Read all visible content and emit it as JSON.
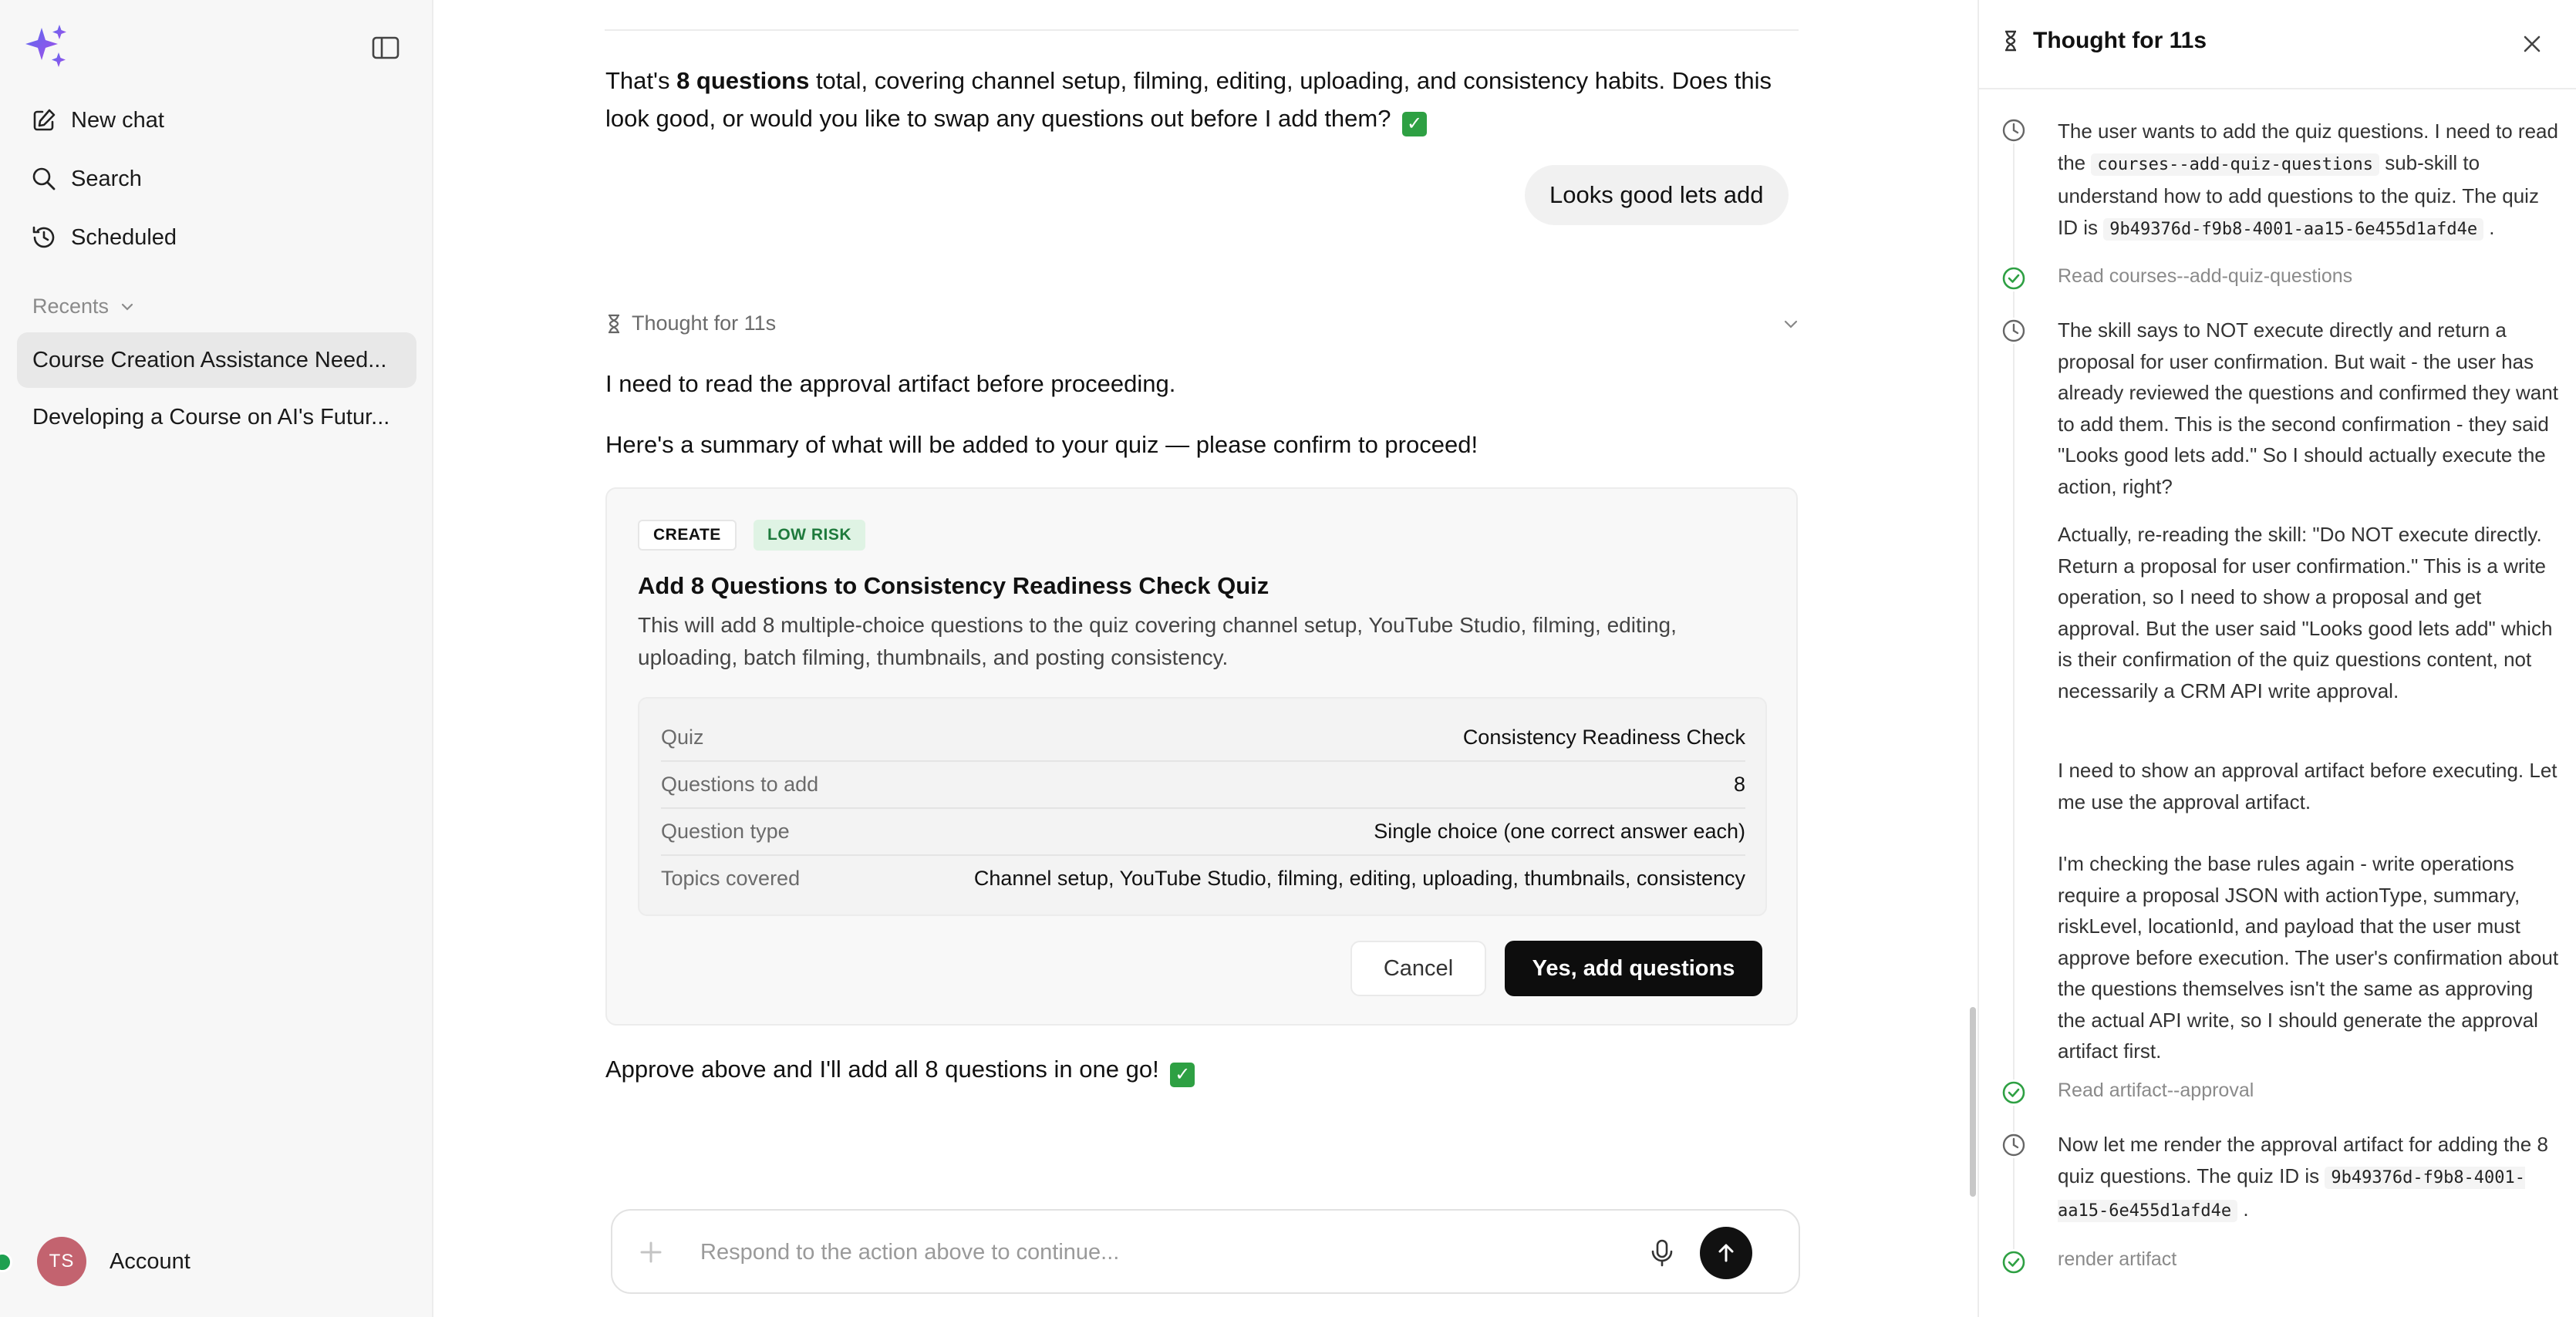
{
  "sidebar": {
    "nav": [
      {
        "label": "New chat",
        "icon": "edit-icon"
      },
      {
        "label": "Search",
        "icon": "search-icon"
      },
      {
        "label": "Scheduled",
        "icon": "history-icon"
      }
    ],
    "recents_label": "Recents",
    "recents": [
      {
        "label": "Course Creation Assistance Need...",
        "active": true
      },
      {
        "label": "Developing a Course on AI's Futur...",
        "active": false
      }
    ],
    "account": {
      "initials": "TS",
      "label": "Account"
    }
  },
  "chat": {
    "intro": {
      "prefix": "That's ",
      "bold": "8 questions",
      "suffix": " total, covering channel setup, filming, editing, uploading, and consistency habits. Does this look good, or would you like to swap any questions out before I add them? ",
      "check": "✅"
    },
    "user_message": "Looks good lets add",
    "thought_label": "Thought for 11s",
    "line1": "I need to read the approval artifact before proceeding.",
    "line2": "Here's a summary of what will be added to your quiz — please confirm to proceed!",
    "card": {
      "tag_action": "CREATE",
      "tag_risk": "LOW RISK",
      "title": "Add 8 Questions to Consistency Readiness Check Quiz",
      "description": "This will add 8 multiple-choice questions to the quiz covering channel setup, YouTube Studio, filming, editing, uploading, batch filming, thumbnails, and posting consistency.",
      "rows": [
        {
          "key": "Quiz",
          "value": "Consistency Readiness Check"
        },
        {
          "key": "Questions to add",
          "value": "8"
        },
        {
          "key": "Question type",
          "value": "Single choice (one correct answer each)"
        },
        {
          "key": "Topics covered",
          "value": "Channel setup, YouTube Studio, filming, editing, uploading, thumbnails, consistency"
        }
      ],
      "cancel_label": "Cancel",
      "confirm_label": "Yes, add questions"
    },
    "closing": {
      "text": "Approve above and I'll add all 8 questions in one go! ",
      "check": "✅"
    },
    "composer_placeholder": "Respond to the action above to continue..."
  },
  "panel": {
    "title": "Thought for 11s",
    "steps": [
      {
        "type": "thought",
        "parts": [
          "The user wants to add the quiz questions. I need to read the ",
          "courses--add-quiz-questions",
          " sub-skill to understand how to add questions to the quiz. The quiz ID is ",
          "9b49376d-f9b8-4001-aa15-6e455d1afd4e",
          " ."
        ]
      },
      {
        "type": "action",
        "text": "Read courses--add-quiz-questions"
      },
      {
        "type": "thought",
        "paragraphs": [
          "The skill says to NOT execute directly and return a proposal for user confirmation. But wait - the user has already reviewed the questions and confirmed they want to add them. This is the second confirmation - they said \"Looks good lets add.\" So I should actually execute the action, right?",
          "Actually, re-reading the skill: \"Do NOT execute directly. Return a proposal for user confirmation.\" This is a write operation, so I need to show a proposal and get approval. But the user said \"Looks good lets add\" which is their confirmation of the quiz questions content, not necessarily a CRM API write approval.",
          "I need to show an approval artifact before executing. Let me use the approval artifact.",
          "I'm checking the base rules again - write operations require a proposal JSON with actionType, summary, riskLevel, locationId, and payload that the user must approve before execution. The user's confirmation about the questions themselves isn't the same as approving the actual API write, so I should generate the approval artifact first."
        ]
      },
      {
        "type": "action",
        "text": "Read artifact--approval"
      },
      {
        "type": "thought",
        "parts": [
          "Now let me render the approval artifact for adding the 8 quiz questions. The quiz ID is ",
          "9b49376d-f9b8-4001-aa15-6e455d1afd4e",
          " ."
        ]
      },
      {
        "type": "action",
        "text": "render artifact"
      }
    ]
  },
  "colors": {
    "accent_logo": "#7b4cf0",
    "risk_bg": "#dff3e4",
    "risk_text": "#1e7a3c",
    "success": "#2ea043",
    "avatar": "#c3636f"
  }
}
